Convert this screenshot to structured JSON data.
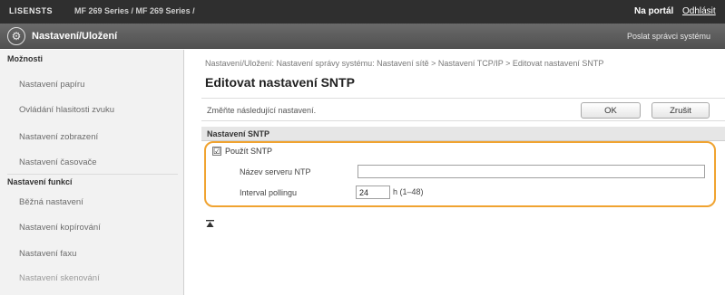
{
  "topbar": {
    "brand": "LISENSTS",
    "model": "MF 269 Series / MF 269 Series /",
    "portal_link": "Na portál",
    "logout_link": "Odhlásit"
  },
  "header": {
    "title": "Nastavení/Uložení",
    "send_link": "Poslat správci systému"
  },
  "sidebar": {
    "section1": "Možnosti",
    "items1": [
      "Nastavení papíru",
      "Ovládání hlasitosti zvuku",
      "Nastavení zobrazení",
      "Nastavení časovače"
    ],
    "section2": "Nastavení funkcí",
    "items2": [
      "Běžná nastavení",
      "Nastavení kopírování",
      "Nastavení faxu",
      "Nastavení skenování"
    ]
  },
  "main": {
    "breadcrumb": "Nastavení/Uložení: Nastavení správy systému: Nastavení sítě > Nastavení TCP/IP > Editovat nastavení SNTP",
    "title": "Editovat nastavení SNTP",
    "prompt": "Změňte následující nastavení.",
    "ok_label": "OK",
    "cancel_label": "Zrušit",
    "section_title": "Nastavení SNTP",
    "use_sntp_label": "Použít SNTP",
    "use_sntp_checked": "☑",
    "ntp_server_label": "Název serveru NTP",
    "ntp_server_value": "",
    "polling_label": "Interval pollingu",
    "polling_value": "24",
    "polling_unit": "h (1–48)"
  },
  "colors": {
    "highlight": "#f0a330",
    "topbar": "#2f2f2f",
    "titlebar": "#5e5e5e"
  }
}
